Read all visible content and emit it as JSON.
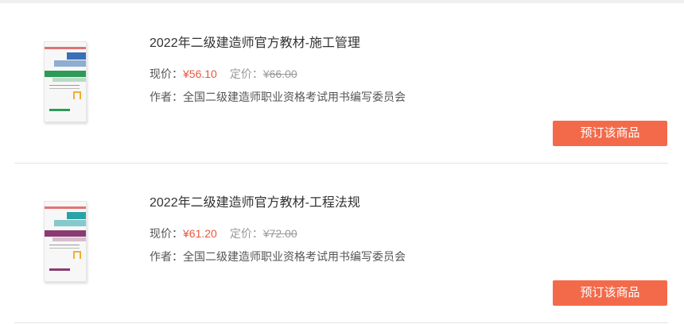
{
  "products": [
    {
      "title": "2022年二级建造师官方教材-施工管理",
      "current_price_label": "现价：",
      "current_price": "¥56.10",
      "list_price_label": "定价：",
      "list_price": "¥66.00",
      "author_label": "作者：",
      "author": "全国二级建造师职业资格考试用书编写委员会",
      "order_button": "预订该商品",
      "cover_colors": {
        "primary": "#2e9a57",
        "secondary": "#3a6fb5"
      }
    },
    {
      "title": "2022年二级建造师官方教材-工程法规",
      "current_price_label": "现价：",
      "current_price": "¥61.20",
      "list_price_label": "定价：",
      "list_price": "¥72.00",
      "author_label": "作者：",
      "author": "全国二级建造师职业资格考试用书编写委员会",
      "order_button": "预订该商品",
      "cover_colors": {
        "primary": "#8a3b72",
        "secondary": "#2ba3a6"
      }
    }
  ],
  "colors": {
    "accent": "#f36a4a",
    "price": "#e9573f",
    "muted": "#999999",
    "divider": "#e4e4e4"
  }
}
